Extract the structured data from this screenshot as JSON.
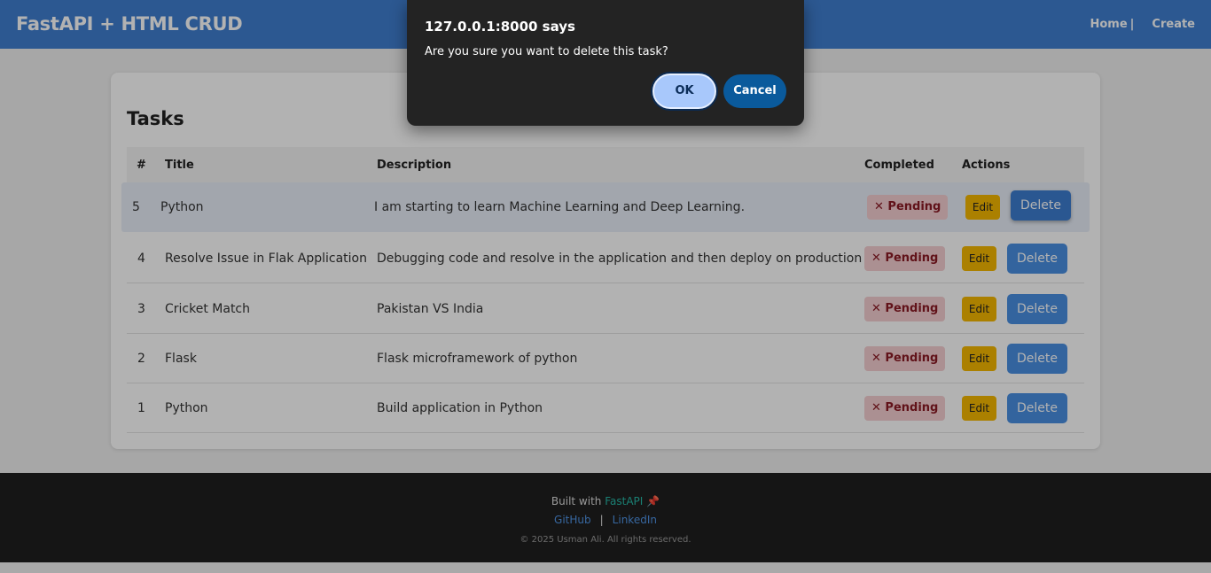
{
  "navbar": {
    "brand": "FastAPI + HTML CRUD",
    "home_label": "Home",
    "separator": "|",
    "create_label": "Create"
  },
  "tasks": {
    "title": "Tasks",
    "headers": {
      "num": "#",
      "title": "Title",
      "description": "Description",
      "completed": "Completed",
      "actions": "Actions"
    },
    "rows": [
      {
        "id": "5",
        "title": "Python",
        "description": "I am starting to learn Machine Learning and Deep Learning.",
        "status": "Pending",
        "edit": "Edit",
        "delete": "Delete"
      },
      {
        "id": "4",
        "title": "Resolve Issue in Flak Application",
        "description": "Debugging code and resolve in the application and then deploy on production",
        "status": "Pending",
        "edit": "Edit",
        "delete": "Delete"
      },
      {
        "id": "3",
        "title": "Cricket Match",
        "description": "Pakistan VS India",
        "status": "Pending",
        "edit": "Edit",
        "delete": "Delete"
      },
      {
        "id": "2",
        "title": "Flask",
        "description": "Flask microframework of python",
        "status": "Pending",
        "edit": "Edit",
        "delete": "Delete"
      },
      {
        "id": "1",
        "title": "Python",
        "description": "Build application in Python",
        "status": "Pending",
        "edit": "Edit",
        "delete": "Delete"
      }
    ],
    "status_icon": "x-icon"
  },
  "footer": {
    "built_with": "Built with",
    "framework": "FastAPI",
    "rocket_icon": "rocket-icon",
    "github": "GitHub",
    "pipe": "|",
    "linkedin": "LinkedIn",
    "copyright": "© 2025 Usman Ali. All rights reserved."
  },
  "dialog": {
    "title": "127.0.0.1:8000 says",
    "message": "Are you sure you want to delete this task?",
    "ok_label": "OK",
    "cancel_label": "Cancel"
  },
  "colors": {
    "navbar": "#3f7fd0",
    "badge_bg": "#f5cfd1",
    "badge_text": "#8b1a25",
    "edit": "#f5b800",
    "delete": "#4a90e2",
    "footer": "#1f1f1f",
    "dialog": "#232323",
    "ok": "#a8c8fb",
    "cancel": "#0a5a9c"
  }
}
